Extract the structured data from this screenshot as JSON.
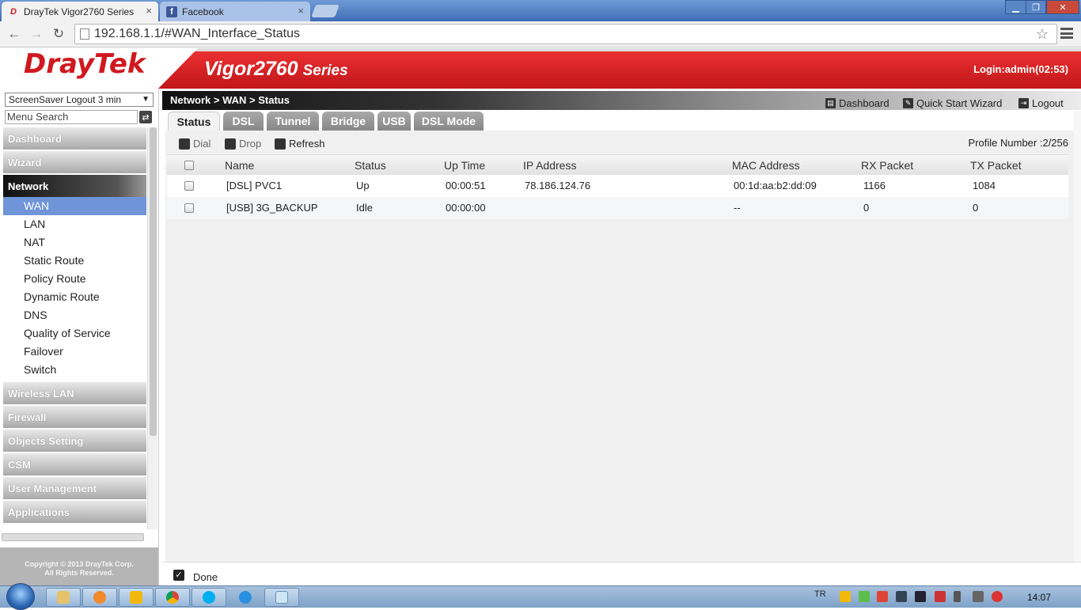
{
  "browser": {
    "tabs": [
      {
        "title": "DrayTek Vigor2760 Series",
        "active": true,
        "icon": "draytek-favicon"
      },
      {
        "title": "Facebook",
        "active": false,
        "icon": "facebook-favicon"
      }
    ],
    "url": "192.168.1.1/#WAN_Interface_Status",
    "close_symbol": "×"
  },
  "header": {
    "logo": "DrayTek",
    "product": "Vigor2760",
    "product_suffix": "Series",
    "login": "Login:admin(02:53)"
  },
  "sidebar": {
    "screensaver": "ScreenSaver Logout 3 min",
    "menu_search": "Menu Search",
    "groups": [
      {
        "label": "Dashboard"
      },
      {
        "label": "Wizard"
      },
      {
        "label": "Network"
      },
      {
        "label": "Wireless LAN"
      },
      {
        "label": "Firewall"
      },
      {
        "label": "Objects Setting"
      },
      {
        "label": "CSM"
      },
      {
        "label": "User Management"
      },
      {
        "label": "Applications"
      }
    ],
    "network_items": [
      "WAN",
      "LAN",
      "NAT",
      "Static Route",
      "Policy Route",
      "Dynamic Route",
      "DNS",
      "Quality of Service",
      "Failover",
      "Switch"
    ],
    "copyright_1": "Copyright © 2013 DrayTek Corp.",
    "copyright_2": "All Rights Reserved."
  },
  "main": {
    "breadcrumb": "Network > WAN > Status",
    "links": {
      "dashboard": "Dashboard",
      "quick_start": "Quick Start Wizard",
      "logout": "Logout"
    },
    "tabs": [
      "Status",
      "DSL",
      "Tunnel",
      "Bridge",
      "USB",
      "DSL Mode"
    ],
    "actions": {
      "dial": "Dial",
      "drop": "Drop",
      "refresh": "Refresh"
    },
    "profile_number": "Profile Number :2/256",
    "columns": [
      "Name",
      "Status",
      "Up Time",
      "IP Address",
      "MAC Address",
      "RX Packet",
      "TX Packet"
    ],
    "rows": [
      {
        "name": "[DSL] PVC1",
        "status": "Up",
        "uptime": "00:00:51",
        "ip": "78.186.124.76",
        "mac": "00:1d:aa:b2:dd:09",
        "rx": "1166",
        "tx": "1084"
      },
      {
        "name": "[USB] 3G_BACKUP",
        "status": "Idle",
        "uptime": "00:00:00",
        "ip": "",
        "mac": "--",
        "rx": "0",
        "tx": "0"
      }
    ],
    "done": "Done"
  },
  "taskbar": {
    "lang": "TR",
    "clock": "14:07",
    "apps": [
      "explorer-icon",
      "media-player-icon",
      "outlook-icon",
      "chrome-icon",
      "skype-icon",
      "internet-explorer-icon",
      "notepad-icon"
    ]
  },
  "colors": {
    "brand_red": "#d0181f",
    "nav_active": "#6f95d8"
  }
}
